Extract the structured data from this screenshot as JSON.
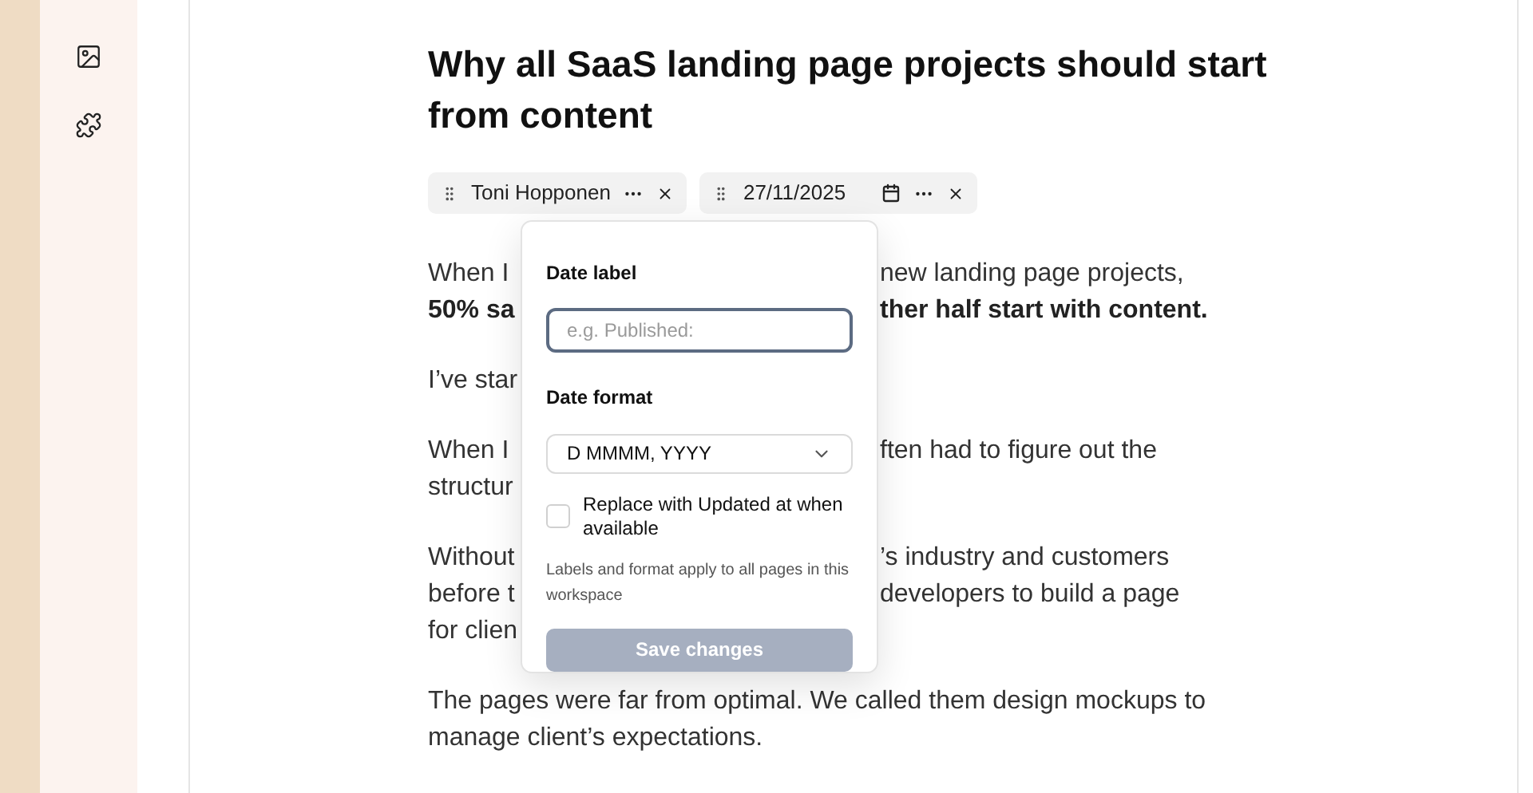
{
  "article": {
    "title": "Why all SaaS landing page projects should start from content",
    "chips": [
      {
        "kind": "author",
        "text": "Toni Hopponen"
      },
      {
        "kind": "date",
        "text": "27/11/2025"
      }
    ],
    "paragraphs": [
      {
        "lines": [
          {
            "left": "When I",
            "right": "new landing page projects,",
            "bold": false
          },
          {
            "left": "50% sa",
            "right": "ther half start with content.",
            "bold": true
          }
        ]
      },
      {
        "lines": [
          {
            "left": "I’ve star",
            "bold": false
          }
        ]
      },
      {
        "lines": [
          {
            "left": "When I",
            "right": "ften had to figure out the",
            "bold": false
          },
          {
            "left": "structur",
            "bold": false
          }
        ]
      },
      {
        "lines": [
          {
            "left": "Without",
            "right": "’s industry and customers",
            "bold": false
          },
          {
            "left": "before t",
            "right": "developers to build a page",
            "bold": false
          },
          {
            "left": "for clien",
            "bold": false
          }
        ]
      },
      {
        "lines": [
          {
            "left": "The pages were far from optimal. We called them design mockups to",
            "bold": false
          },
          {
            "left": "manage client’s expectations.",
            "bold": false
          }
        ]
      }
    ]
  },
  "popover": {
    "date_label": {
      "label": "Date label",
      "placeholder": "e.g. Published:"
    },
    "date_format": {
      "label": "Date format",
      "value": "D MMMM, YYYY"
    },
    "checkbox": {
      "label": "Replace with Updated at when available",
      "checked": false
    },
    "note": "Labels and format apply to all pages in this workspace",
    "save_button": {
      "label": "Save changes",
      "disabled": true
    }
  }
}
